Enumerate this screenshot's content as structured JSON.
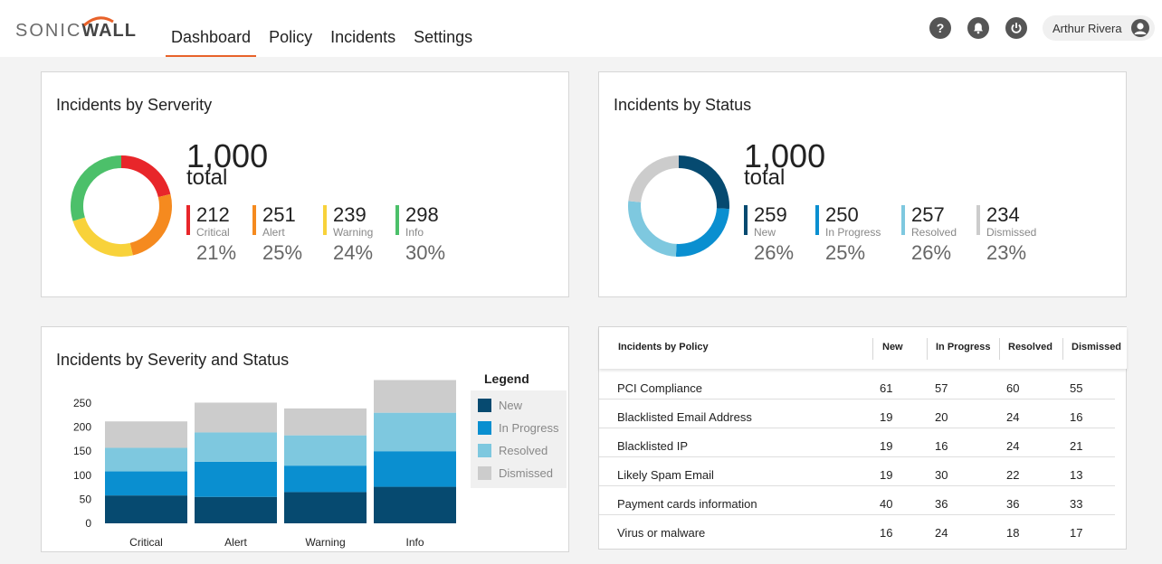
{
  "brand": {
    "name_part1": "SONIC",
    "name_part2": "WALL"
  },
  "nav": {
    "items": [
      {
        "label": "Dashboard",
        "active": true
      },
      {
        "label": "Policy",
        "active": false
      },
      {
        "label": "Incidents",
        "active": false
      },
      {
        "label": "Settings",
        "active": false
      }
    ]
  },
  "header": {
    "help_icon": "question-circle-icon",
    "notifications_icon": "bell-icon",
    "power_icon": "power-icon",
    "user_name": "Arthur Rivera",
    "user_icon": "user-avatar-icon"
  },
  "colors": {
    "accent": "#e8622a",
    "critical": "#e8262a",
    "alert": "#f58a1f",
    "warning": "#f8d23a",
    "info": "#4cc06a",
    "new": "#064a70",
    "in_progress": "#0a8fd0",
    "resolved": "#7ec8df",
    "dismissed": "#cccccc"
  },
  "severity_card": {
    "title": "Incidents by Serverity",
    "total": "1,000",
    "total_label": "total",
    "stats": [
      {
        "value": "212",
        "label": "Critical",
        "percent": "21%",
        "color": "#e8262a",
        "count": 212
      },
      {
        "value": "251",
        "label": "Alert",
        "percent": "25%",
        "color": "#f58a1f",
        "count": 251
      },
      {
        "value": "239",
        "label": "Warning",
        "percent": "24%",
        "color": "#f8d23a",
        "count": 239
      },
      {
        "value": "298",
        "label": "Info",
        "percent": "30%",
        "color": "#4cc06a",
        "count": 298
      }
    ]
  },
  "status_card": {
    "title": "Incidents by Status",
    "total": "1,000",
    "total_label": "total",
    "stats": [
      {
        "value": "259",
        "label": "New",
        "percent": "26%",
        "color": "#064a70",
        "count": 259
      },
      {
        "value": "250",
        "label": "In Progress",
        "percent": "25%",
        "color": "#0a8fd0",
        "count": 250
      },
      {
        "value": "257",
        "label": "Resolved",
        "percent": "26%",
        "color": "#7ec8df",
        "count": 257
      },
      {
        "value": "234",
        "label": "Dismissed",
        "percent": "23%",
        "color": "#cccccc",
        "count": 234
      }
    ]
  },
  "stacked_card": {
    "title": "Incidents by Severity and Status",
    "legend_title": "Legend",
    "chart_data": {
      "type": "bar",
      "stacked": true,
      "categories": [
        "Critical",
        "Alert",
        "Warning",
        "Info"
      ],
      "series": [
        {
          "name": "New",
          "color": "#064a70",
          "values": [
            58,
            55,
            65,
            76
          ]
        },
        {
          "name": "In Progress",
          "color": "#0a8fd0",
          "values": [
            50,
            73,
            55,
            74
          ]
        },
        {
          "name": "Resolved",
          "color": "#7ec8df",
          "values": [
            49,
            61,
            63,
            80
          ]
        },
        {
          "name": "Dismissed",
          "color": "#cccccc",
          "values": [
            55,
            62,
            56,
            68
          ]
        }
      ],
      "y_ticks": [
        "250",
        "200",
        "150",
        "100",
        "50",
        "0"
      ],
      "ylim": [
        0,
        250
      ]
    }
  },
  "policy_table": {
    "columns": [
      "Incidents by Policy",
      "New",
      "In Progress",
      "Resolved",
      "Dismissed"
    ],
    "rows": [
      [
        "PCI Compliance",
        "61",
        "57",
        "60",
        "55"
      ],
      [
        "Blacklisted Email Address",
        "19",
        "20",
        "24",
        "16"
      ],
      [
        "Blacklisted IP",
        "19",
        "16",
        "24",
        "21"
      ],
      [
        "Likely Spam Email",
        "19",
        "30",
        "22",
        "13"
      ],
      [
        "Payment cards information",
        "40",
        "36",
        "36",
        "33"
      ],
      [
        "Virus or malware",
        "16",
        "24",
        "18",
        "17"
      ]
    ]
  }
}
